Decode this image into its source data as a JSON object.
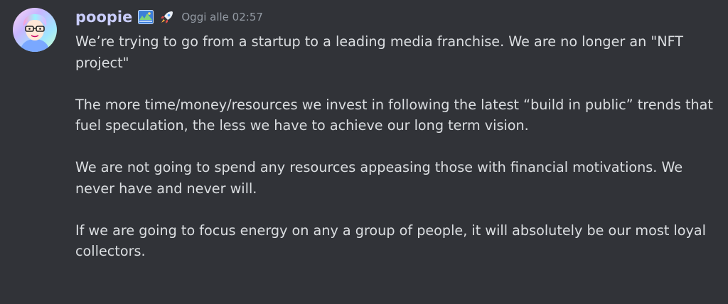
{
  "message": {
    "username": "poopie",
    "timestamp": "Oggi alle 02:57",
    "avatar_icon": "avatar-icon",
    "badge_icon": "map-badge-icon",
    "rocket_icon": "rocket-icon",
    "paragraphs": [
      "We’re trying to go from a startup to a leading media franchise. We are no longer an \"NFT project\"",
      "The more time/money/resources we invest in following the latest “build in public” trends that fuel speculation, the less we have to achieve our long term vision.",
      "We are not going to spend any resources appeasing those with financial motivations. We never have and never will.",
      "If we are going to focus energy on any a group of people, it will absolutely be our most loyal collectors."
    ]
  },
  "colors": {
    "background": "#313338",
    "username": "#c9cdfb",
    "text": "#dbdee1",
    "timestamp": "#949ba4"
  }
}
